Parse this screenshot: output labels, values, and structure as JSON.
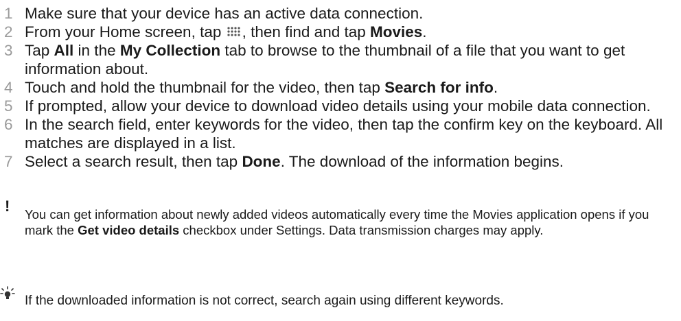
{
  "steps": [
    {
      "num": "1",
      "text": "Make sure that your device has an active data connection."
    },
    {
      "num": "2",
      "pre": "From your Home screen, tap ",
      "icon": "apps-grid-icon",
      "mid": ", then find and tap ",
      "bold": "Movies",
      "post": "."
    },
    {
      "num": "3",
      "pre": "Tap ",
      "bold1": "All",
      "mid": " in the ",
      "bold2": "My Collection",
      "post": " tab to browse to the thumbnail of a file that you want to get information about."
    },
    {
      "num": "4",
      "pre": "Touch and hold the thumbnail for the video, then tap ",
      "bold": "Search for info",
      "post": "."
    },
    {
      "num": "5",
      "text": "If prompted, allow your device to download video details using your mobile data connection."
    },
    {
      "num": "6",
      "text": "In the search field, enter keywords for the video, then tap the confirm key on the keyboard. All matches are displayed in a list."
    },
    {
      "num": "7",
      "pre": "Select a search result, then tap ",
      "bold": "Done",
      "post": ". The download of the information begins."
    }
  ],
  "note": {
    "icon": "exclamation-icon",
    "symbol": "!",
    "pre": "You can get information about newly added videos automatically every time the Movies application opens if you mark the ",
    "bold": "Get video details",
    "post": " checkbox under Settings. Data transmission charges may apply."
  },
  "tip": {
    "icon": "lightbulb-icon",
    "text": "If the downloaded information is not correct, search again using different keywords."
  }
}
